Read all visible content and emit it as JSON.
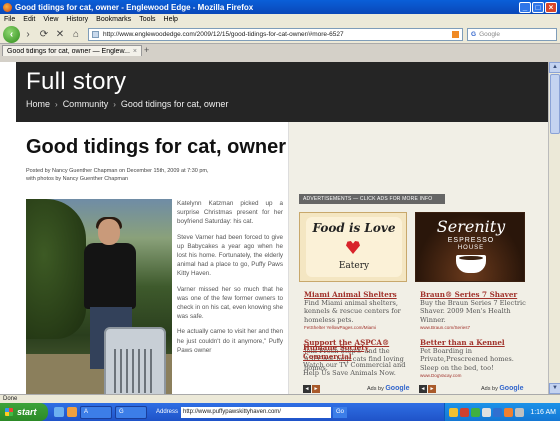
{
  "window": {
    "title": "Good tidings for cat, owner - Englewood Edge - Mozilla Firefox",
    "min": "_",
    "max": "□",
    "close": "×"
  },
  "menu": [
    "File",
    "Edit",
    "View",
    "History",
    "Bookmarks",
    "Tools",
    "Help"
  ],
  "nav": {
    "back": "‹",
    "forward": "›",
    "reload": "⟳",
    "stop": "✕",
    "home": "⌂",
    "url": "http://www.englewoodedge.com/2009/12/15/good-tidings-for-cat-owner/#more-6527",
    "search_engine": "G",
    "search_placeholder": "Google"
  },
  "tab": {
    "label": "Good tidings for cat, owner — Englew...",
    "close": "×",
    "new": "+"
  },
  "page": {
    "section_title": "Full story",
    "breadcrumb": [
      "Home",
      "Community",
      "Good tidings for cat, owner"
    ],
    "breadcrumb_sep": "›",
    "article_title": "Good tidings for cat, owner",
    "byline_1": "Posted by Nancy Guenther Chapman on December 15th, 2009 at 7:30 pm,",
    "byline_2": "with photos by Nancy Guenther Chapman",
    "paragraphs": [
      "Katelynn Katzman picked up a surprise Christmas present for her boyfriend Saturday: his cat.",
      "Steve Varner had been forced to give up Babycakes a year ago when he lost his home. Fortunately, the elderly animal had a place to go, Puffy Paws Kitty Haven.",
      "Varner missed her so much that he was one of the few former owners to check in on his cat, even knowing she was safe.",
      "He actually came to visit her and then he just couldn't do it anymore,\" Puffy Paws owner"
    ]
  },
  "ads": {
    "header": "ADVERTISEMENTS — CLICK ADS FOR MORE INFO",
    "image1": {
      "line1": "Food is Love",
      "line2": "Eatery"
    },
    "image2": {
      "line1": "Serenity",
      "line2": "ESPRESSO",
      "line3": "HOUSE"
    },
    "left": [
      {
        "title": "Miami Animal Shelters",
        "desc": "Find Miami animal shelters, kennels & rescue centers for homeless pets.",
        "url": "FetShelter YellowPages.com/Miami"
      },
      {
        "title": "Support the ASPCA®",
        "desc": "Join Fresh Step® and the ASPCA® help cats find loving homes.",
        "url": "www.FreshStep.com/Litter"
      }
    ],
    "right": [
      {
        "title": "Braun® Series 7 Shaver",
        "desc": "Buy the Braun Series 7 Electric Shaver. 2009 Men's Health Winner.",
        "url": "www.Braun.com/Series7"
      },
      {
        "title": "Better than a Kennel",
        "desc": "Pet Boarding in Private,Prescreened homes. Sleep on the bed, too!",
        "url": "www.DogVacay.com"
      }
    ],
    "bottom": {
      "title": "Humane Society Commercial",
      "desc": "Watch our TV Commercial and Help Us Save Animals Now."
    },
    "ads_by": "Ads by",
    "google": "Google",
    "nav_prev": "◄",
    "nav_next": "►"
  },
  "status": "Done",
  "taskbar": {
    "start": "start",
    "tasks": [
      "A",
      "G"
    ],
    "address_label": "Address",
    "address": "http://www.puffypawskittyhaven.com/",
    "go": "Go",
    "clock": "1:16 AM"
  },
  "colors": {
    "ad_link": "#a1322b",
    "hero_bg": "#252525",
    "sidebar_bg": "#f1efe6"
  }
}
